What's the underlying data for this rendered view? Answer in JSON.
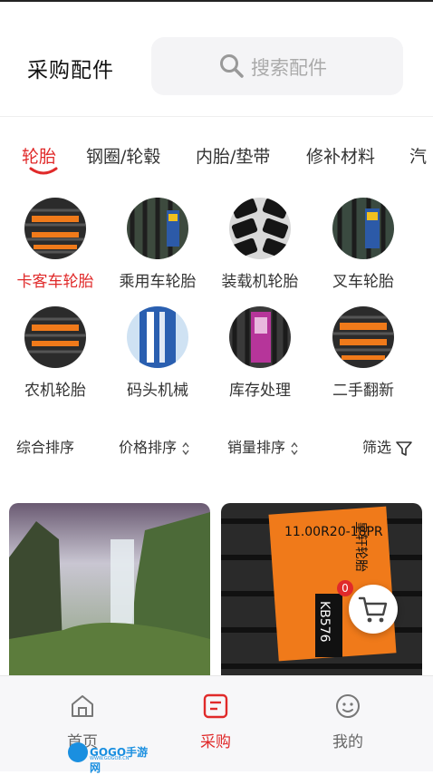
{
  "header": {
    "title": "采购配件",
    "search_placeholder": "搜索配件"
  },
  "tabs": [
    {
      "label": "轮胎",
      "active": true
    },
    {
      "label": "钢圈/轮毂",
      "active": false
    },
    {
      "label": "内胎/垫带",
      "active": false
    },
    {
      "label": "修补材料",
      "active": false
    },
    {
      "label": "汽",
      "active": false
    }
  ],
  "categories": [
    {
      "label": "卡客车轮胎",
      "active": true,
      "icon": "truck-tire-image"
    },
    {
      "label": "乘用车轮胎",
      "active": false,
      "icon": "car-tire-image"
    },
    {
      "label": "装载机轮胎",
      "active": false,
      "icon": "loader-tire-image"
    },
    {
      "label": "叉车轮胎",
      "active": false,
      "icon": "forklift-tire-image"
    },
    {
      "label": "农机轮胎",
      "active": false,
      "icon": "farm-tire-image"
    },
    {
      "label": "码头机械",
      "active": false,
      "icon": "port-machinery-image"
    },
    {
      "label": "库存处理",
      "active": false,
      "icon": "stock-clearance-image"
    },
    {
      "label": "二手翻新",
      "active": false,
      "icon": "retread-tire-image"
    }
  ],
  "sort": {
    "overall": "综合排序",
    "price": "价格排序",
    "sales": "销量排序",
    "filter": "筛选"
  },
  "products": [
    {
      "image": "waterfall-landscape-image"
    },
    {
      "image": "tire-product-image",
      "tire_size": "11.00R20-18PR",
      "brand": "皇轩轮胎",
      "model": "KB576"
    }
  ],
  "cart": {
    "count": "0"
  },
  "tabbar": [
    {
      "label": "首页",
      "active": false,
      "icon": "home-icon"
    },
    {
      "label": "采购",
      "active": true,
      "icon": "purchase-icon"
    },
    {
      "label": "我的",
      "active": false,
      "icon": "profile-icon"
    }
  ],
  "watermark": {
    "text": "GOGO手游网",
    "url": "WWW.GOGO8.CN"
  },
  "colors": {
    "accent": "#e02a2a",
    "search_bg": "#f4f4f6",
    "tabbar_bg": "#f7f7f9"
  }
}
